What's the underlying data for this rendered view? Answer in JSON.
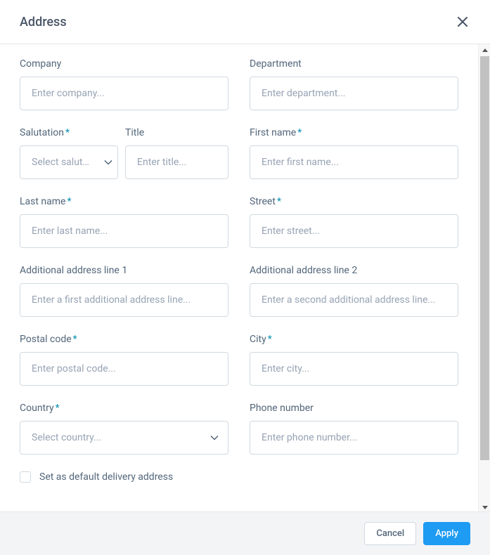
{
  "modal": {
    "title": "Address"
  },
  "fields": {
    "company": {
      "label": "Company",
      "placeholder": "Enter company..."
    },
    "department": {
      "label": "Department",
      "placeholder": "Enter department..."
    },
    "salutation": {
      "label": "Salutation",
      "placeholder": "Select salutation..."
    },
    "title": {
      "label": "Title",
      "placeholder": "Enter title..."
    },
    "firstname": {
      "label": "First name",
      "placeholder": "Enter first name..."
    },
    "lastname": {
      "label": "Last name",
      "placeholder": "Enter last name..."
    },
    "street": {
      "label": "Street",
      "placeholder": "Enter street..."
    },
    "addr1": {
      "label": "Additional address line 1",
      "placeholder": "Enter a first additional address line..."
    },
    "addr2": {
      "label": "Additional address line 2",
      "placeholder": "Enter a second additional address line..."
    },
    "postal": {
      "label": "Postal code",
      "placeholder": "Enter postal code..."
    },
    "city": {
      "label": "City",
      "placeholder": "Enter city..."
    },
    "country": {
      "label": "Country",
      "placeholder": "Select country..."
    },
    "phone": {
      "label": "Phone number",
      "placeholder": "Enter phone number..."
    }
  },
  "checkbox": {
    "default_delivery": "Set as default delivery address"
  },
  "footer": {
    "cancel": "Cancel",
    "apply": "Apply"
  },
  "required_marker": "*"
}
